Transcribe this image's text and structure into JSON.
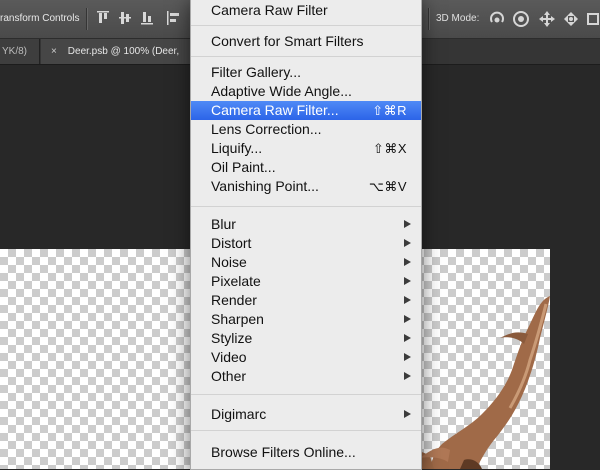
{
  "options_bar": {
    "transform_label": "ransform Controls",
    "mode_label": "3D Mode:",
    "align_icons": [
      "align-top-edges-icon",
      "align-vertical-centers-icon",
      "align-bottom-edges-icon",
      "align-left-edges-icon"
    ],
    "mode_icons": [
      "3d-rotate-icon",
      "3d-roll-icon",
      "3d-pan-icon",
      "3d-slide-icon",
      "3d-scale-icon"
    ]
  },
  "tabs": {
    "previous": "YK/8)",
    "close_glyph": "×",
    "active": "Deer.psb @ 100% (Deer,"
  },
  "menu": {
    "top": [
      {
        "label": "Camera Raw Filter"
      },
      {
        "label": "Convert for Smart Filters"
      }
    ],
    "filters": [
      {
        "label": "Filter Gallery...",
        "shortcut": ""
      },
      {
        "label": "Adaptive Wide Angle...",
        "shortcut": ""
      },
      {
        "label": "Camera Raw Filter...",
        "shortcut": "⇧⌘R",
        "highlighted": true
      },
      {
        "label": "Lens Correction...",
        "shortcut": ""
      },
      {
        "label": "Liquify...",
        "shortcut": "⇧⌘X"
      },
      {
        "label": "Oil Paint...",
        "shortcut": ""
      },
      {
        "label": "Vanishing Point...",
        "shortcut": "⌥⌘V"
      }
    ],
    "submenus": [
      "Blur",
      "Distort",
      "Noise",
      "Pixelate",
      "Render",
      "Sharpen",
      "Stylize",
      "Video",
      "Other"
    ],
    "digimarc": "Digimarc",
    "browse": "Browse Filters Online..."
  },
  "colors": {
    "highlight": "#3a72ee",
    "menu_bg": "#ececec",
    "options_bar": "#505050",
    "canvas_bg": "#282828",
    "antler": "#a06a48"
  }
}
